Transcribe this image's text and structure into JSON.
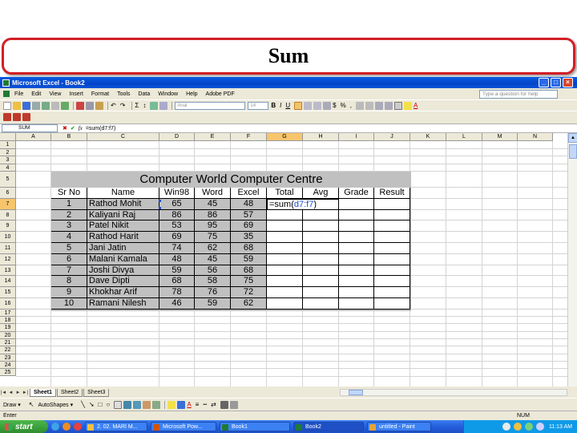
{
  "slide": {
    "title": "Sum"
  },
  "window": {
    "title": "Microsoft Excel - Book2",
    "min": "_",
    "max": "□",
    "close": "×"
  },
  "menu": [
    "File",
    "Edit",
    "View",
    "Insert",
    "Format",
    "Tools",
    "Data",
    "Window",
    "Help",
    "Adobe PDF"
  ],
  "help_placeholder": "Type a question for help",
  "toolbar": {
    "font": "Arial",
    "size": "14",
    "bold": "B",
    "italic": "I",
    "underline": "U",
    "currency": "$",
    "percent": "%",
    "comma": ",",
    "sigma": "Σ",
    "font_color": "A"
  },
  "formula_bar": {
    "name_box": "SUM",
    "cancel": "✖",
    "enter": "✔",
    "fx": "fx",
    "formula": "=sum(d7:f7)"
  },
  "columns": [
    "A",
    "B",
    "C",
    "D",
    "E",
    "F",
    "G",
    "H",
    "I",
    "J",
    "K",
    "L",
    "M",
    "N"
  ],
  "rows": [
    "1",
    "2",
    "3",
    "4",
    "5",
    "6",
    "7",
    "8",
    "9",
    "10",
    "11",
    "12",
    "13",
    "14",
    "15",
    "16",
    "17",
    "18",
    "19",
    "20",
    "21",
    "22",
    "23",
    "24",
    "25"
  ],
  "table": {
    "title": "Computer World Computer Centre",
    "headers": [
      "Sr No",
      "Name",
      "Win98",
      "Word",
      "Excel",
      "Total",
      "Avg",
      "Grade",
      "Result"
    ],
    "rows": [
      [
        "1",
        "Rathod Mohit",
        "65",
        "45",
        "48"
      ],
      [
        "2",
        "Kaliyani Raj",
        "86",
        "86",
        "57"
      ],
      [
        "3",
        "Patel Nikit",
        "53",
        "95",
        "69"
      ],
      [
        "4",
        "Rathod Harit",
        "69",
        "75",
        "35"
      ],
      [
        "5",
        "Jani Jatin",
        "74",
        "62",
        "68"
      ],
      [
        "6",
        "Malani Kamala",
        "48",
        "45",
        "59"
      ],
      [
        "7",
        "Joshi Divya",
        "59",
        "56",
        "68"
      ],
      [
        "8",
        "Dave Dipti",
        "68",
        "58",
        "75"
      ],
      [
        "9",
        "Khokhar Arif",
        "78",
        "76",
        "72"
      ],
      [
        "10",
        "Ramani Nilesh",
        "46",
        "59",
        "62"
      ]
    ],
    "editing_cell": {
      "prefix": "=sum(",
      "ref": "d7:f7",
      "suffix": ")"
    }
  },
  "sheet_tabs": [
    "Sheet1",
    "Sheet2",
    "Sheet3"
  ],
  "tab_nav": [
    "|◄",
    "◄",
    "►",
    "►|"
  ],
  "draw": {
    "draw_label": "Draw ▾",
    "autoshapes_label": "AutoShapes ▾"
  },
  "status": {
    "mode": "Enter",
    "num": "NUM"
  },
  "taskbar": {
    "start": "start",
    "tasks": [
      "2. 02. MARI M...",
      "Microsoft Pow...",
      "Book1",
      "Book2",
      "untitled - Paint"
    ],
    "clock": "11:13 AM"
  },
  "colors": {
    "accent_red": "#d21f26",
    "xp_blue": "#0343c9",
    "table_gray": "#c0c0c0",
    "ref_blue": "#1f4fd8"
  }
}
